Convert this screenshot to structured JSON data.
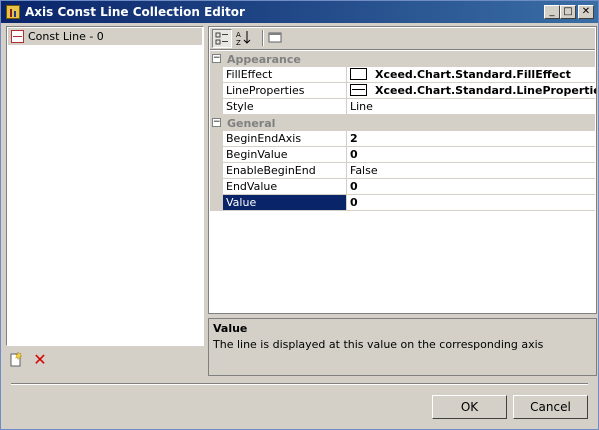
{
  "window": {
    "title": "Axis Const Line Collection Editor"
  },
  "titlebar_buttons": {
    "minimize": "_",
    "maximize": "□",
    "close": "✕"
  },
  "list": {
    "items": [
      {
        "label": "Const Line - 0",
        "selected": true
      }
    ]
  },
  "list_toolbar": {
    "add": "add-icon",
    "delete": "delete-icon"
  },
  "grid_toolbar": {
    "categorized": "categorized-icon",
    "alphabetical": "alphabetical-icon",
    "property_pages": "property-pages-icon"
  },
  "grid": {
    "categories": [
      {
        "name": "Appearance",
        "toggle": "⊟",
        "properties": [
          {
            "name": "FillEffect",
            "value": "Xceed.Chart.Standard.FillEffect"
          },
          {
            "name": "LineProperties",
            "value": "Xceed.Chart.Standard.LineProperties"
          },
          {
            "name": "Style",
            "value": "Line"
          }
        ]
      },
      {
        "name": "General",
        "toggle": "⊟",
        "properties": [
          {
            "name": "BeginEndAxis",
            "value": "2"
          },
          {
            "name": "BeginValue",
            "value": "0"
          },
          {
            "name": "EnableBeginEnd",
            "value": "False"
          },
          {
            "name": "EndValue",
            "value": "0"
          },
          {
            "name": "Value",
            "value": "0",
            "selected": true
          }
        ]
      }
    ]
  },
  "description": {
    "title": "Value",
    "text": "The line is displayed at this value on the corresponding axis"
  },
  "buttons": {
    "ok": "OK",
    "cancel": "Cancel"
  },
  "colors": {
    "titlebar_start": "#0a246a",
    "titlebar_end": "#3a6ea5",
    "selection": "#0a246a",
    "face": "#d4d0c8",
    "delete": "#d40000"
  }
}
